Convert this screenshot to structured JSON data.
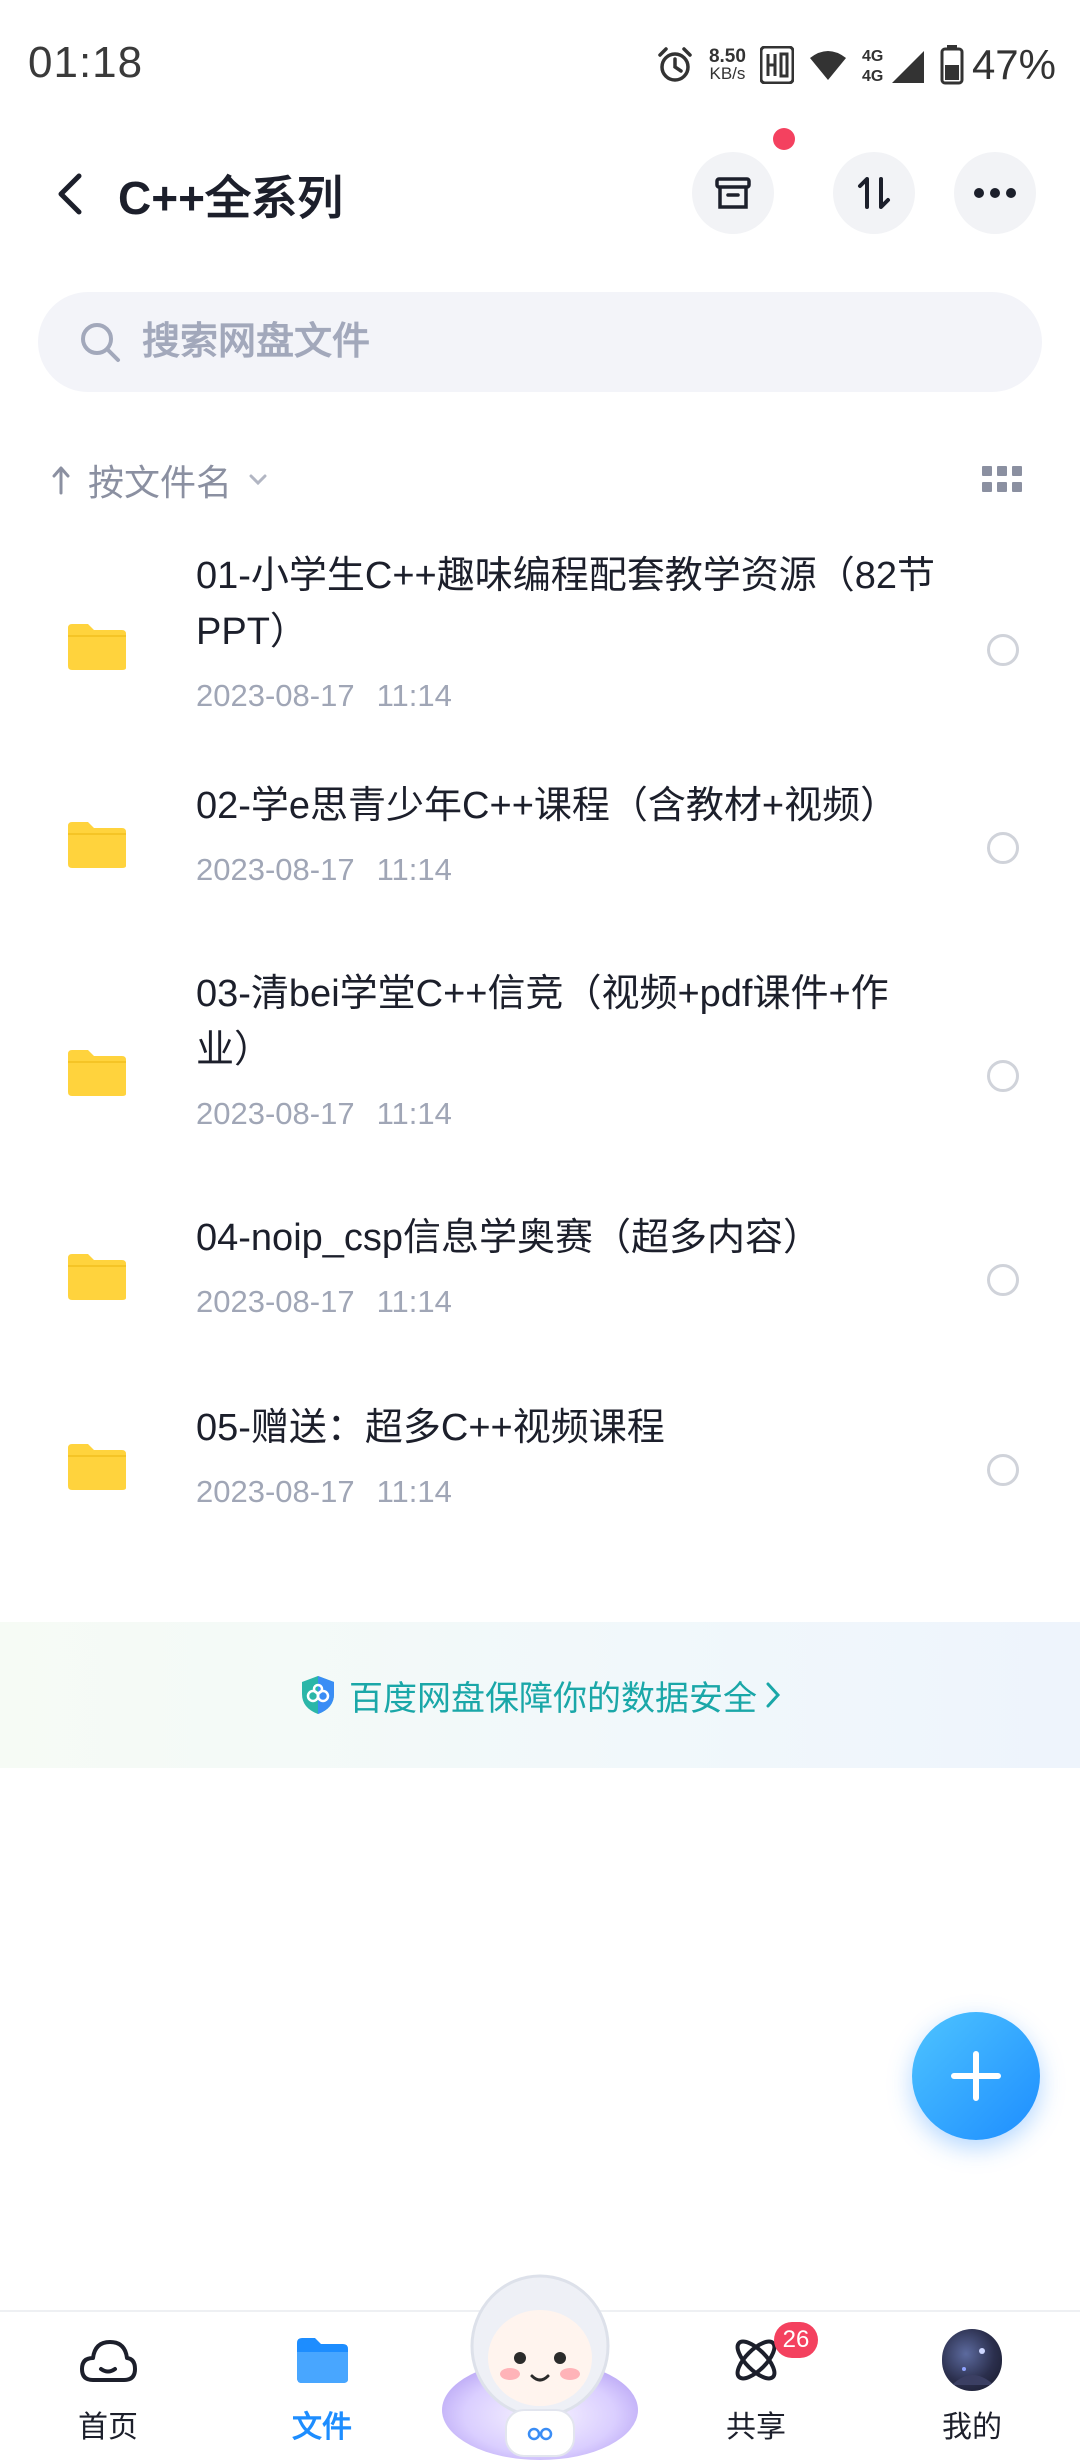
{
  "status_bar": {
    "time": "01:18",
    "net_speed_value": "8.50",
    "net_speed_unit": "KB/s",
    "battery": "47%"
  },
  "header": {
    "title": "C++全系列",
    "icons": [
      "back-icon",
      "archive-icon",
      "sort-icon",
      "more-icon"
    ]
  },
  "search": {
    "placeholder": "搜索网盘文件"
  },
  "sort": {
    "label": "按文件名"
  },
  "files": [
    {
      "name": "01-小学生C++趣味编程配套教学资源（82节PPT）",
      "date": "2023-08-17",
      "time": "11:14"
    },
    {
      "name": "02-学e思青少年C++课程（含教材+视频）",
      "date": "2023-08-17",
      "time": "11:14"
    },
    {
      "name": "03-清bei学堂C++信竞（视频+pdf课件+作业）",
      "date": "2023-08-17",
      "time": "11:14"
    },
    {
      "name": "04-noip_csp信息学奥赛（超多内容）",
      "date": "2023-08-17",
      "time": "11:14"
    },
    {
      "name": "05-赠送：超多C++视频课程",
      "date": "2023-08-17",
      "time": "11:14"
    }
  ],
  "security_banner": {
    "text": "百度网盘保障你的数据安全"
  },
  "bottom_nav": {
    "home": "首页",
    "files": "文件",
    "share": "共享",
    "share_badge": "26",
    "mine": "我的"
  },
  "colors": {
    "accent": "#1d8dff",
    "folder": "#ffd33d",
    "badge": "#f4415f",
    "security": "#1aa7a8"
  }
}
